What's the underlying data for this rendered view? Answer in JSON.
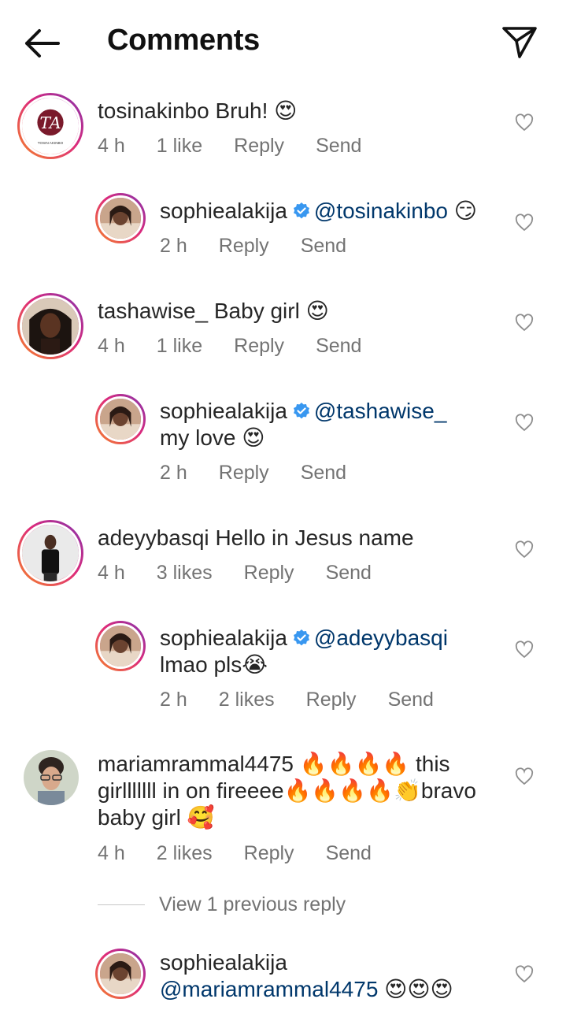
{
  "header": {
    "title": "Comments",
    "back_icon": "arrow-left-icon",
    "share_icon": "paper-plane-icon"
  },
  "colors": {
    "mention": "#00376b",
    "meta": "#737373",
    "text": "#262626",
    "story_ring": "#dd2a7b"
  },
  "comments": [
    {
      "username": "tosinakinbo",
      "text": "Bruh! 😍",
      "time": "4 h",
      "likes": "1 like",
      "reply_label": "Reply",
      "send_label": "Send",
      "avatar_text": "TOSIN AKINBO",
      "replies": [
        {
          "username": "sophiealakija",
          "mention": "@tosinakinbo",
          "text": "😏",
          "time": "2 h",
          "reply_label": "Reply",
          "send_label": "Send"
        }
      ]
    },
    {
      "username": "tashawise_",
      "text": "Baby girl 😍",
      "time": "4 h",
      "likes": "1 like",
      "reply_label": "Reply",
      "send_label": "Send",
      "replies": [
        {
          "username": "sophiealakija",
          "mention": "@tashawise_",
          "text": "my love 😍",
          "time": "2 h",
          "reply_label": "Reply",
          "send_label": "Send"
        }
      ]
    },
    {
      "username": "adeyybasqi",
      "text": "Hello in Jesus name",
      "time": "4 h",
      "likes": "3 likes",
      "reply_label": "Reply",
      "send_label": "Send",
      "replies": [
        {
          "username": "sophiealakija",
          "mention": "@adeyybasqi",
          "text": "lmao pls😭",
          "time": "2 h",
          "likes": "2 likes",
          "reply_label": "Reply",
          "send_label": "Send"
        }
      ]
    },
    {
      "username": "mariamrammal4475",
      "text": "🔥🔥🔥🔥 this girlllllll in on fireeee🔥🔥🔥🔥👏bravo baby girl 🥰",
      "time": "4 h",
      "likes": "2 likes",
      "reply_label": "Reply",
      "send_label": "Send",
      "view_replies": "View 1 previous reply",
      "replies": [
        {
          "username": "sophiealakija",
          "mention": "@mariamrammal4475",
          "text": "😍😍😍"
        }
      ]
    }
  ]
}
